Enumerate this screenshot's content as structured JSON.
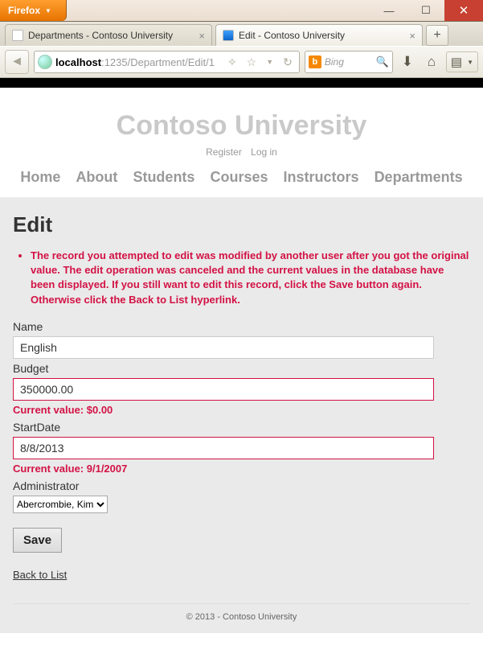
{
  "firefox_button": "Firefox",
  "tabs": [
    {
      "title": "Departments - Contoso University"
    },
    {
      "title": "Edit - Contoso University"
    }
  ],
  "url": {
    "host": "localhost",
    "rest": ":1235/Department/Edit/1"
  },
  "search_engine_letter": "b",
  "search_placeholder": "Bing",
  "site_title": "Contoso University",
  "auth": {
    "register": "Register",
    "login": "Log in"
  },
  "nav": {
    "home": "Home",
    "about": "About",
    "students": "Students",
    "courses": "Courses",
    "instructors": "Instructors",
    "departments": "Departments"
  },
  "page_header": "Edit",
  "error_message": "The record you attempted to edit was modified by another user after you got the original value. The edit operation was canceled and the current values in the database have been displayed. If you still want to edit this record, click the Save button again. Otherwise click the Back to List hyperlink.",
  "fields": {
    "name": {
      "label": "Name",
      "value": "English",
      "invalid": false,
      "current": null
    },
    "budget": {
      "label": "Budget",
      "value": "350000.00",
      "invalid": true,
      "current": "Current value: $0.00"
    },
    "start": {
      "label": "StartDate",
      "value": "8/8/2013",
      "invalid": true,
      "current": "Current value: 9/1/2007"
    },
    "admin": {
      "label": "Administrator",
      "value": "Abercrombie, Kim"
    }
  },
  "save_label": "Save",
  "back_label": "Back to List",
  "footer": "© 2013 - Contoso University"
}
